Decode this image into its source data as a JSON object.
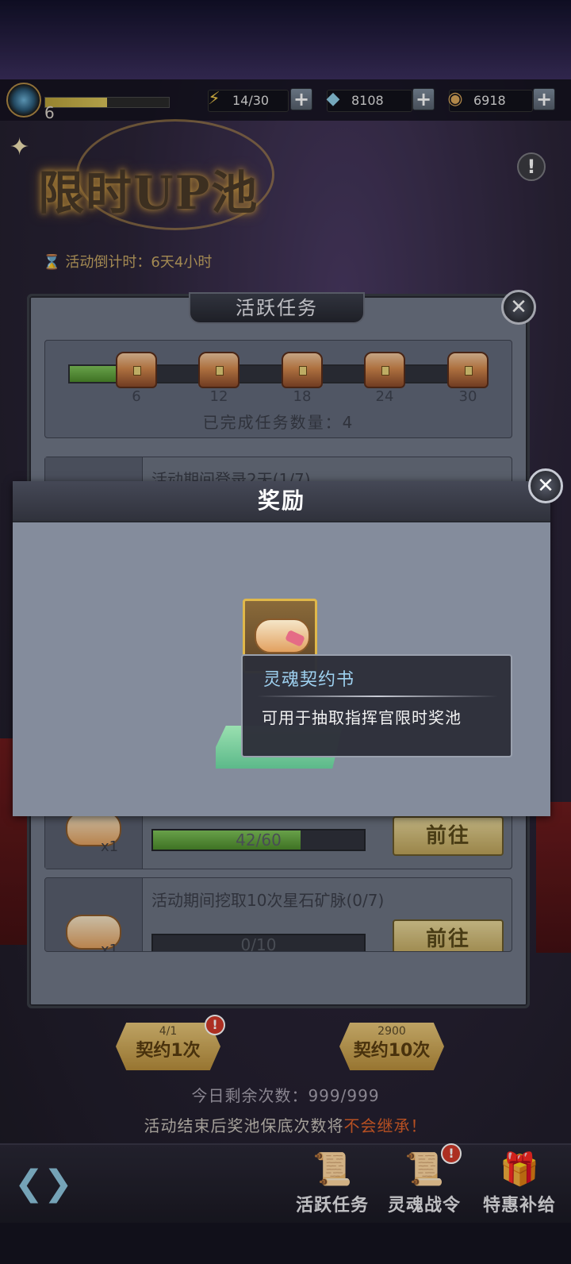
{
  "resources": {
    "player_level": "6",
    "exp_progress": 0.5,
    "stamina": "14/30",
    "diamonds": "8108",
    "coins": "6918",
    "stamina_icon": "lightning-icon",
    "diamond_icon": "diamond-icon",
    "coin_icon": "coin-icon"
  },
  "event": {
    "title": "限时UP池",
    "countdown_label": "活动倒计时：",
    "countdown_value": "6天4小时"
  },
  "task_panel": {
    "title": "活跃任务",
    "milestones": [
      "6",
      "12",
      "18",
      "24",
      "30"
    ],
    "progress": 0.13,
    "completed_label": "已完成任务数量：4",
    "tasks": [
      {
        "title": "活动期间登录2天(1/7)"
      },
      {
        "qty": "x1",
        "progress_text": "42/60",
        "progress": 0.7,
        "button": "前往"
      },
      {
        "title": "活动期间挖取10次星石矿脉(0/7)",
        "qty": "x1",
        "progress_text": "0/10",
        "progress": 0,
        "button": "前往"
      }
    ]
  },
  "reward_modal": {
    "title": "奖励"
  },
  "tooltip": {
    "title": "灵魂契约书",
    "description": "可用于抽取指挥官限时奖池"
  },
  "summon": {
    "single_cost": "4/1",
    "single_label": "契约1次",
    "ten_cost": "2900",
    "ten_label": "契约10次",
    "alert": "!"
  },
  "remaining": "今日剩余次数：999/999",
  "pity_note_prefix": "活动结束后奖池保底次数将",
  "pity_note_warn": "不会继承！",
  "nav": {
    "items": [
      {
        "label": "活跃任务",
        "icon": "scroll-quest-icon"
      },
      {
        "label": "灵魂战令",
        "icon": "soul-pass-icon"
      },
      {
        "label": "特惠补给",
        "icon": "gift-box-icon"
      }
    ]
  }
}
